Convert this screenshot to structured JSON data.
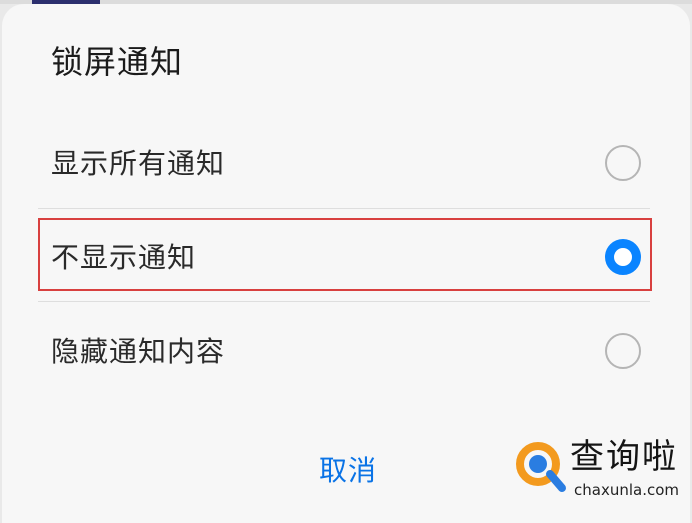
{
  "dialog": {
    "title": "锁屏通知",
    "options": [
      {
        "label": "显示所有通知",
        "selected": false
      },
      {
        "label": "不显示通知",
        "selected": true
      },
      {
        "label": "隐藏通知内容",
        "selected": false
      }
    ],
    "cancel_label": "取消"
  },
  "watermark": {
    "name": "查询啦",
    "url": "chaxunla.com"
  },
  "colors": {
    "accent": "#0a84ff",
    "cancel_text": "#0a73e6",
    "highlight_border": "#d8403f",
    "watermark_orange": "#f39a1e",
    "watermark_blue": "#2a7de1"
  }
}
